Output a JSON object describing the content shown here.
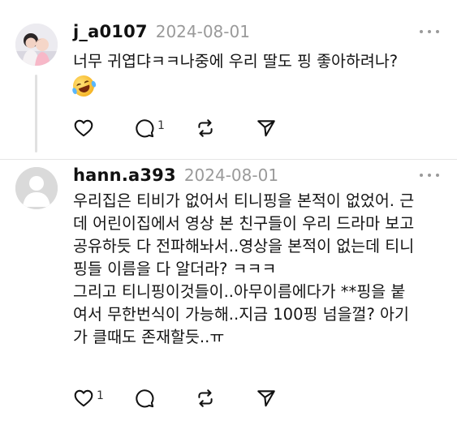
{
  "posts": [
    {
      "username": "j_a0107",
      "timestamp": "2024-08-01",
      "lines": [
        "너무 귀엽댜ㅋㅋ나중에 우리 딸도 핑 좋아하려나?"
      ],
      "emoji": "rolling-on-floor-laughing-emoji",
      "actions": {
        "like_count": "",
        "comment_count": "1",
        "repost_count": "",
        "share_count": ""
      }
    },
    {
      "username": "hann.a393",
      "timestamp": "2024-08-01",
      "lines": [
        "우리집은 티비가 없어서 티니핑을 본적이 없었어. 근",
        "데 어린이집에서 영상 본 친구들이 우리 드라마 보고",
        "공유하듯 다 전파해놔서..영상을 본적이 없는데 티니",
        "핑들 이름을 다 알더라? ㅋㅋㅋ",
        "그리고 티니핑이것들이..아무이름에다가 **핑을 붙",
        "여서 무한번식이 가능해..지금 100핑 넘을껄? 아기",
        "가 클때도 존재할듯..ㅠ"
      ],
      "actions": {
        "like_count": "1",
        "comment_count": "",
        "repost_count": "",
        "share_count": ""
      }
    }
  ],
  "icons": {
    "like": "heart-icon",
    "comment": "comment-bubble-icon",
    "repost": "repost-icon",
    "share": "send-icon",
    "more": "more-dots-icon"
  },
  "colors": {
    "text": "#141414",
    "muted": "#9a9a9a",
    "divider": "#e6e6e6",
    "icon": "#111111"
  }
}
